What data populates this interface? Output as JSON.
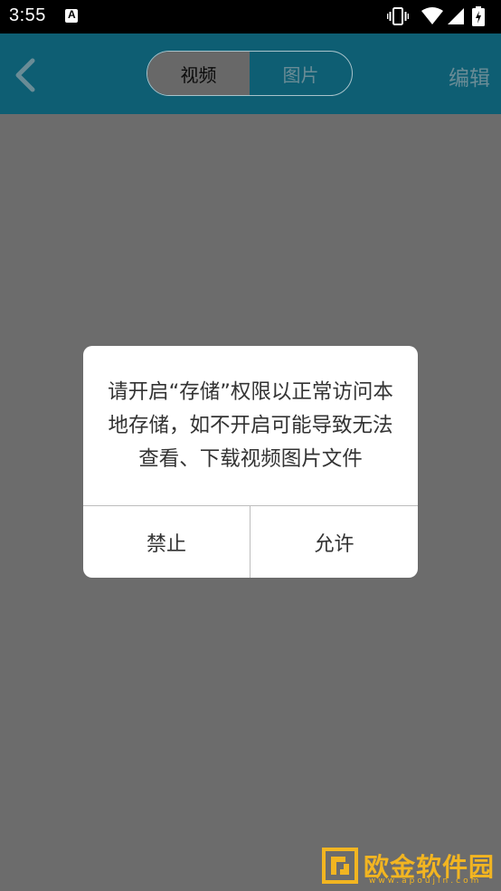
{
  "status_bar": {
    "time": "3:55",
    "notification_icon": "A",
    "icons": [
      "vibrate-icon",
      "wifi-icon",
      "signal-icon",
      "battery-charging-icon"
    ]
  },
  "header": {
    "back_icon": "chevron-left-icon",
    "tabs": [
      {
        "label": "视频",
        "active": true
      },
      {
        "label": "图片",
        "active": false
      }
    ],
    "edit_label": "编辑"
  },
  "dialog": {
    "message": "请开启“存储”权限以正常访问本地存储，如不开启可能导致无法查看、下载视频图片文件",
    "deny_label": "禁止",
    "allow_label": "允许"
  },
  "watermark": {
    "text": "欧金软件园",
    "url": "www.apoujin.com"
  },
  "colors": {
    "overlay_bg": "#6c6c6c",
    "header_bg": "#0e5e73",
    "dialog_bg": "#ffffff",
    "watermark": "#f2b521"
  }
}
